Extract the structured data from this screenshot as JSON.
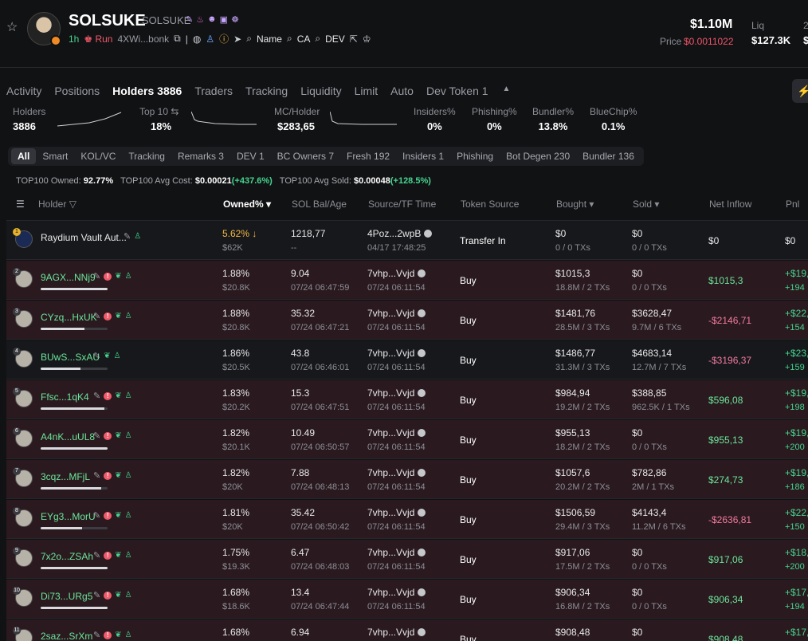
{
  "token": {
    "name": "SOLSUKE",
    "symbol": "SOLSUKE",
    "age": "1h",
    "run_label": "Run",
    "address": "4XWi...bonk",
    "search_name": "Name",
    "search_ca": "CA",
    "search_dev": "DEV"
  },
  "market": {
    "mc": "$1.10M",
    "price_label": "Price",
    "price": "$0.0011022",
    "liq_label": "Liq",
    "liq": "$127.3K",
    "cut_label": "2",
    "cut_value": "$"
  },
  "tabs": [
    {
      "label": "Activity"
    },
    {
      "label": "Positions"
    },
    {
      "label": "Holders 3886"
    },
    {
      "label": "Traders"
    },
    {
      "label": "Tracking"
    },
    {
      "label": "Liquidity"
    },
    {
      "label": "Limit"
    },
    {
      "label": "Auto"
    },
    {
      "label": "Dev Token 1"
    }
  ],
  "stats": [
    {
      "label": "Holders",
      "value": "3886"
    },
    {
      "label": "Top 10 ⇆",
      "value": "18%"
    },
    {
      "label": "MC/Holder",
      "value": "$283,65"
    },
    {
      "label": "Insiders%",
      "value": "0%"
    },
    {
      "label": "Phishing%",
      "value": "0%"
    },
    {
      "label": "Bundler%",
      "value": "13.8%"
    },
    {
      "label": "BlueChip%",
      "value": "0.1%"
    }
  ],
  "chips": [
    {
      "label": "All"
    },
    {
      "label": "Smart"
    },
    {
      "label": "KOL/VC"
    },
    {
      "label": "Tracking"
    },
    {
      "label": "Remarks 3"
    },
    {
      "label": "DEV 1"
    },
    {
      "label": "BC Owners 7"
    },
    {
      "label": "Fresh 192"
    },
    {
      "label": "Insiders 1"
    },
    {
      "label": "Phishing"
    },
    {
      "label": "Bot Degen 230"
    },
    {
      "label": "Bundler 136"
    }
  ],
  "summary": {
    "owned_label": "TOP100 Owned:",
    "owned": "92.77%",
    "cost_label": "TOP100 Avg Cost:",
    "cost": "$0.00021",
    "cost_change": "(+437.6%)",
    "sold_label": "TOP100 Avg Sold:",
    "sold": "$0.00048",
    "sold_change": "(+128.5%)"
  },
  "columns": {
    "holder": "Holder",
    "owned": "Owned%",
    "sol": "SOL Bal/Age",
    "source": "Source/TF Time",
    "token_source": "Token Source",
    "bought": "Bought",
    "sold": "Sold",
    "net": "Net Inflow",
    "pnl": "Pnl"
  },
  "rows": [
    {
      "rank": "1",
      "name": "Raydium Vault Aut...",
      "owned": "5.62%",
      "value": "$62K",
      "sol": "1218,77",
      "age": "--",
      "src": "4Poz...2wpB",
      "tf": "04/17 17:48:25",
      "tsrc": "Transfer In",
      "bought": "$0",
      "bought_tx": "0 / 0 TXs",
      "sold": "$0",
      "sold_tx": "0 / 0 TXs",
      "net": "$0",
      "pnl1": "$0",
      "pnl2": "",
      "style": "dark",
      "bar": 0
    },
    {
      "rank": "2",
      "name": "9AGX...NNj9",
      "owned": "1.88%",
      "value": "$20.8K",
      "sol": "9.04",
      "age": "07/24 06:47:59",
      "src": "7vhp...Vvjd",
      "tf": "07/24 06:11:54",
      "tsrc": "Buy",
      "bought": "$1015,3",
      "bought_tx": "18.8M / 2 TXs",
      "sold": "$0",
      "sold_tx": "0 / 0 TXs",
      "net": "$1015,3",
      "pnl1": "+$19,",
      "pnl2": "+194",
      "style": "red",
      "bar": 1.0
    },
    {
      "rank": "3",
      "name": "CYzq...HxUK",
      "owned": "1.88%",
      "value": "$20.8K",
      "sol": "35.32",
      "age": "07/24 06:47:21",
      "src": "7vhp...Vvjd",
      "tf": "07/24 06:11:54",
      "tsrc": "Buy",
      "bought": "$1481,76",
      "bought_tx": "28.5M / 3 TXs",
      "sold": "$3628,47",
      "sold_tx": "9.7M / 6 TXs",
      "net": "-$2146,71",
      "pnl1": "+$22,",
      "pnl2": "+154",
      "style": "red",
      "bar": 0.66
    },
    {
      "rank": "4",
      "name": "BUwS...SxAU",
      "owned": "1.86%",
      "value": "$20.5K",
      "sol": "43.8",
      "age": "07/24 06:46:01",
      "src": "7vhp...Vvjd",
      "tf": "07/24 06:11:54",
      "tsrc": "Buy",
      "bought": "$1486,77",
      "bought_tx": "31.3M / 3 TXs",
      "sold": "$4683,14",
      "sold_tx": "12.7M / 7 TXs",
      "net": "-$3196,37",
      "pnl1": "+$23,",
      "pnl2": "+159",
      "style": "dark",
      "bar": 0.6
    },
    {
      "rank": "5",
      "name": "Ffsc...1qK4",
      "owned": "1.83%",
      "value": "$20.2K",
      "sol": "15.3",
      "age": "07/24 06:47:51",
      "src": "7vhp...Vvjd",
      "tf": "07/24 06:11:54",
      "tsrc": "Buy",
      "bought": "$984,94",
      "bought_tx": "19.2M / 2 TXs",
      "sold": "$388,85",
      "sold_tx": "962.5K / 1 TXs",
      "net": "$596,08",
      "pnl1": "+$19,",
      "pnl2": "+198",
      "style": "red",
      "bar": 0.95
    },
    {
      "rank": "6",
      "name": "A4nK...uUL8",
      "owned": "1.82%",
      "value": "$20.1K",
      "sol": "10.49",
      "age": "07/24 06:50:57",
      "src": "7vhp...Vvjd",
      "tf": "07/24 06:11:54",
      "tsrc": "Buy",
      "bought": "$955,13",
      "bought_tx": "18.2M / 2 TXs",
      "sold": "$0",
      "sold_tx": "0 / 0 TXs",
      "net": "$955,13",
      "pnl1": "+$19,",
      "pnl2": "+200",
      "style": "red",
      "bar": 1.0
    },
    {
      "rank": "7",
      "name": "3cqz...MFjL",
      "owned": "1.82%",
      "value": "$20K",
      "sol": "7.88",
      "age": "07/24 06:48:13",
      "src": "7vhp...Vvjd",
      "tf": "07/24 06:11:54",
      "tsrc": "Buy",
      "bought": "$1057,6",
      "bought_tx": "20.2M / 2 TXs",
      "sold": "$782,86",
      "sold_tx": "2M / 1 TXs",
      "net": "$274,73",
      "pnl1": "+$19,",
      "pnl2": "+186",
      "style": "red",
      "bar": 0.9
    },
    {
      "rank": "8",
      "name": "EYg3...MorU",
      "owned": "1.81%",
      "value": "$20K",
      "sol": "35.42",
      "age": "07/24 06:50:42",
      "src": "7vhp...Vvjd",
      "tf": "07/24 06:11:54",
      "tsrc": "Buy",
      "bought": "$1506,59",
      "bought_tx": "29.4M / 3 TXs",
      "sold": "$4143,4",
      "sold_tx": "11.2M / 6 TXs",
      "net": "-$2636,81",
      "pnl1": "+$22,",
      "pnl2": "+150",
      "style": "red",
      "bar": 0.62
    },
    {
      "rank": "9",
      "name": "7x2o...ZSAh",
      "owned": "1.75%",
      "value": "$19.3K",
      "sol": "6.47",
      "age": "07/24 06:48:03",
      "src": "7vhp...Vvjd",
      "tf": "07/24 06:11:54",
      "tsrc": "Buy",
      "bought": "$917,06",
      "bought_tx": "17.5M / 2 TXs",
      "sold": "$0",
      "sold_tx": "0 / 0 TXs",
      "net": "$917,06",
      "pnl1": "+$18,",
      "pnl2": "+200",
      "style": "red",
      "bar": 1.0
    },
    {
      "rank": "10",
      "name": "Di73...URg5",
      "owned": "1.68%",
      "value": "$18.6K",
      "sol": "13.4",
      "age": "07/24 06:47:44",
      "src": "7vhp...Vvjd",
      "tf": "07/24 06:11:54",
      "tsrc": "Buy",
      "bought": "$906,34",
      "bought_tx": "16.8M / 2 TXs",
      "sold": "$0",
      "sold_tx": "0 / 0 TXs",
      "net": "$906,34",
      "pnl1": "+$17,",
      "pnl2": "+194",
      "style": "red",
      "bar": 1.0
    },
    {
      "rank": "11",
      "name": "2saz...SrXm",
      "owned": "1.68%",
      "value": "",
      "sol": "6.94",
      "age": "",
      "src": "7vhp...Vvjd",
      "tf": "",
      "tsrc": "Buy",
      "bought": "$908,48",
      "bought_tx": "",
      "sold": "$0",
      "sold_tx": "",
      "net": "$908,48",
      "pnl1": "+$17,",
      "pnl2": "",
      "style": "red",
      "bar": 1.0
    }
  ]
}
